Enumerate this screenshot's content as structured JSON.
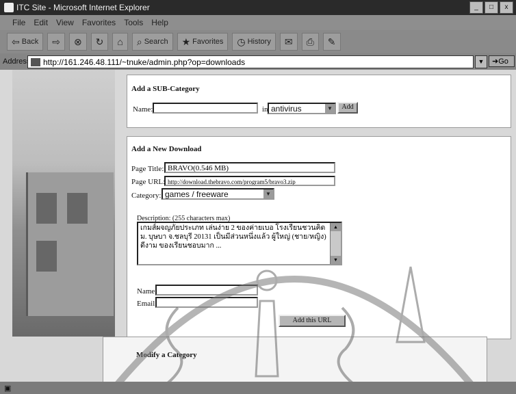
{
  "window": {
    "title": "ITC Site - Microsoft Internet Explorer",
    "controls": [
      "_",
      "□",
      "x"
    ]
  },
  "menu": [
    "File",
    "Edit",
    "View",
    "Favorites",
    "Tools",
    "Help"
  ],
  "toolbar": {
    "back": "Back",
    "search": "Search",
    "favorites": "Favorites",
    "history": "History"
  },
  "address": {
    "label": "Address",
    "url": "http://161.246.48.111/~tnuke/admin.php?op=downloads",
    "go": "Go"
  },
  "subcategory": {
    "heading": "Add a SUB-Category",
    "name_label": "Name:",
    "name_value": "",
    "in_label": "in",
    "parent": "antivirus",
    "add_button": "Add"
  },
  "download": {
    "heading": "Add a New Download",
    "page_title_label": "Page Title:",
    "page_title_value": "BRAVO(0.546 MB)",
    "page_url_label": "Page URL:",
    "page_url_value": "http://download.thebravo.com/program5/bravo3.zip",
    "category_label": "Category:",
    "category_value": "games / freeware",
    "description_label": "Description: (255 characters max)",
    "description_value": "เกมส์ผจญภัยประเภท เล่นง่าย 2 ของค่ายเบอ โรงเรียนชวนคิด ม. บุษบา จ.ชลบุรี 20131 เป็นมีส่วนหนึ่งแล้ว ผู้ใหญ่ (ชาย/หญิง) ดีงาม ของเรียนชอบมาก ...",
    "name_label": "Name:",
    "name_value": "",
    "email_label": "Email:",
    "email_value": "",
    "add_button": "Add this URL"
  },
  "modify": {
    "heading": "Modify a Category"
  },
  "colors": {
    "titlebar": "#2a2a2a",
    "chrome": "#8e8e8e",
    "page": "#ffffff"
  }
}
